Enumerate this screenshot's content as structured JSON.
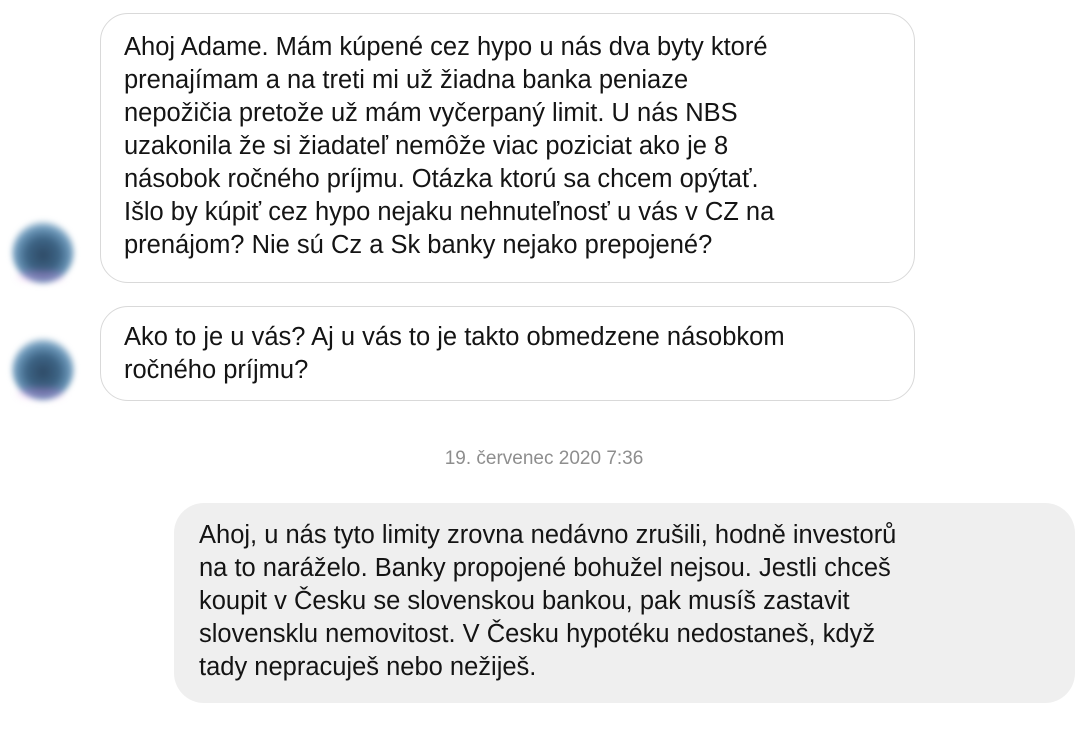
{
  "messages": [
    {
      "lines": [
        "Ahoj Adame. Mám kúpené cez hypo u nás dva byty ktoré",
        "prenajímam a na treti mi už žiadna banka peniaze",
        "nepožičia pretože už mám vyčerpaný limit. U nás NBS",
        "uzakonila že si žiadateľ nemôže viac poziciat ako je 8",
        "násobok ročného príjmu. Otázka ktorú sa chcem opýtať.",
        "Išlo by kúpiť cez hypo nejaku nehnuteľnosť u vás v CZ na",
        "prenájom? Nie sú Cz a Sk banky nejako prepojené?"
      ]
    },
    {
      "lines": [
        "Ako to je u vás? Aj u vás to je takto obmedzene násobkom",
        "ročného príjmu?"
      ]
    },
    {
      "timestamp": "19. červenec 2020 7:36"
    },
    {
      "lines": [
        "Ahoj, u nás tyto limity zrovna nedávno zrušili, hodně investorů",
        "na to naráželo. Banky propojené bohužel nejsou. Jestli chceš",
        "koupit v Česku se slovenskou bankou, pak musíš zastavit",
        "slovensklu nemovitost. V Česku hypotéku nedostaneš, když",
        "tady nepracuješ nebo nežiješ."
      ]
    }
  ]
}
